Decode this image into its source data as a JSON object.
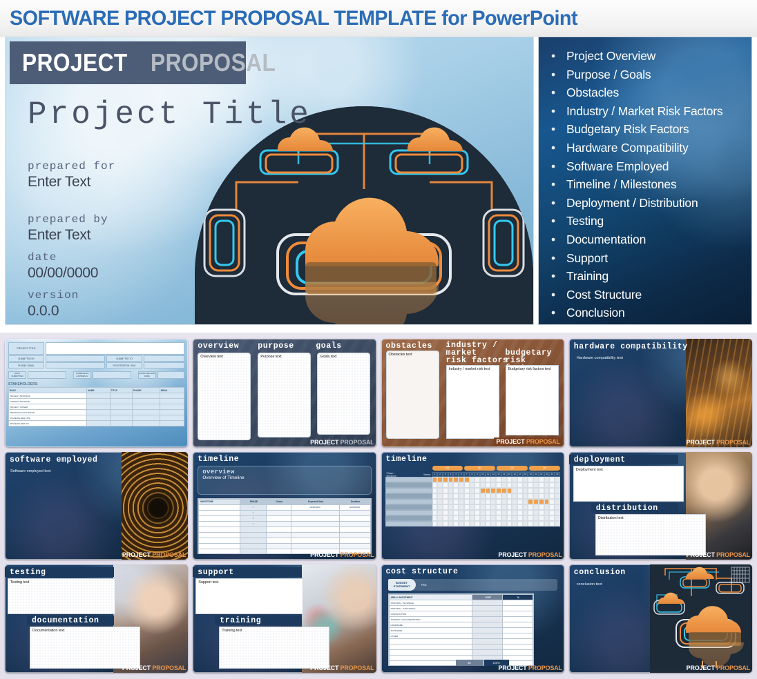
{
  "header": {
    "title": "SOFTWARE PROJECT PROPOSAL TEMPLATE for PowerPoint"
  },
  "title_slide": {
    "badge_bold": "PROJECT",
    "badge_light": "PROPOSAL",
    "project_title": "Project Title",
    "fields": [
      {
        "label": "prepared for",
        "value": "Enter Text"
      },
      {
        "label": "prepared by",
        "value": "Enter Text"
      },
      {
        "label": "date",
        "value": "00/00/0000"
      },
      {
        "label": "version",
        "value": "0.0.0"
      }
    ]
  },
  "agenda": {
    "items": [
      "Project Overview",
      "Purpose / Goals",
      "Obstacles",
      "Industry / Market Risk Factors",
      "Budgetary Risk Factors",
      "Hardware Compatibility",
      "Software Employed",
      "Timeline / Milestones",
      "Deployment / Distribution",
      "Testing",
      "Documentation",
      "Support",
      "Training",
      "Cost Structure",
      "Conclusion"
    ]
  },
  "logo": {
    "bold": "PROJECT",
    "light": "PROPOSAL"
  },
  "thumbnails": {
    "cover_form": {
      "fields": [
        "PROJECT TITLE",
        "SUBMITTED BY",
        "SUBMITTED TO",
        "PHONE / EMAIL",
        "REGISTRATION / SKU",
        "DATE SUBMITTED",
        "SUBMISSION EXPIRES IN",
        "EXPECTED END DATE"
      ],
      "section": "STAKEHOLDERS",
      "columns": [
        "ROLE",
        "NAME",
        "TITLE",
        "PHONE",
        "EMAIL"
      ],
      "rows": [
        "PROJECT SPONSOR",
        "FUNDING SPONSOR",
        "PROJECT OWNER",
        "PROPOSAL FACILITATOR",
        "STAKEHOLDER FIVE",
        "STAKEHOLDER SIX"
      ]
    },
    "overview": {
      "headings": [
        "overview",
        "purpose",
        "goals"
      ],
      "texts": [
        "Overview text",
        "Purpose text",
        "Goals text"
      ]
    },
    "obstacles": {
      "headings": [
        "obstacles",
        "industry /\nmarket\nrisk factors",
        "budgetary\nrisk factors"
      ],
      "h1": "obstacles",
      "h2_l1": "industry /",
      "h2_l2": "market",
      "h2_l3": "risk factors",
      "h3_l1": "budgetary",
      "h3_l2": "risk factors",
      "texts": [
        "Obstacles text",
        "Industry / market risk text",
        "Budgetary risk factors text"
      ]
    },
    "hardware": {
      "title": "hardware compatibility",
      "text": "Hardware compatibility text"
    },
    "software": {
      "title": "software employed",
      "text": "Software employed text"
    },
    "timeline_overview": {
      "title": "timeline",
      "sub": "overview",
      "sub_text": "Overview of Timeline",
      "columns": [
        "MILESTONE",
        "PHASE",
        "Owner",
        "Expected Start",
        "Deadline"
      ],
      "phases": [
        "1",
        "2",
        "3",
        "4"
      ],
      "sample_start": "00/00/0000",
      "sample_deadline": "00/00/0000"
    },
    "timeline_gantt": {
      "title": "timeline",
      "row_header_l1": "Phase /",
      "row_header_l2": "Milestone",
      "weeks_label": "Weeks",
      "quarters": [
        "Q1",
        "Q2",
        "Q3",
        "Q4"
      ],
      "weeks": [
        "1",
        "2",
        "3",
        "4",
        "5",
        "6",
        "7",
        "8",
        "9",
        "10",
        "11",
        "12",
        "13",
        "14",
        "15",
        "16",
        "17",
        "18",
        "19",
        "20",
        "21",
        "22",
        "23",
        "24"
      ],
      "bars": [
        {
          "row": 0,
          "start": 1,
          "span": 7
        },
        {
          "row": 2,
          "start": 10,
          "span": 6
        },
        {
          "row": 4,
          "start": 19,
          "span": 4
        }
      ]
    },
    "deployment": {
      "title": "deployment",
      "text": "Deployment text",
      "title2": "distribution",
      "text2": "Distribution text"
    },
    "testing": {
      "title": "testing",
      "text": "Testing text",
      "title2": "documentation",
      "text2": "Documentation text"
    },
    "support": {
      "title": "support",
      "text": "Support text",
      "title2": "training",
      "text2": "Training text"
    },
    "cost": {
      "title": "cost structure",
      "tab_l1": "BUDGET",
      "tab_l2": "STATEMENT",
      "tab_value": "Text",
      "columns": [
        "AREA / INVESTMENT",
        "COST",
        "%"
      ],
      "rows": [
        "STAFFING - TECHNICAL",
        "STAFFING - FUNCTIONAL",
        "CONSULTATION",
        "TRAINING / DOCUMENTATION",
        "HARDWARE",
        "SOFTWARE",
        "OTHER"
      ],
      "total_cost": "$0",
      "total_pct": "100%"
    },
    "conclusion": {
      "title": "conclusion",
      "text": "conclusion text"
    }
  },
  "colors": {
    "accent_blue": "#2b6cb7",
    "navy": "#1b3a5e",
    "orange": "#f0a04a",
    "slate": "#4e5d77",
    "rust": "#8a5738"
  }
}
